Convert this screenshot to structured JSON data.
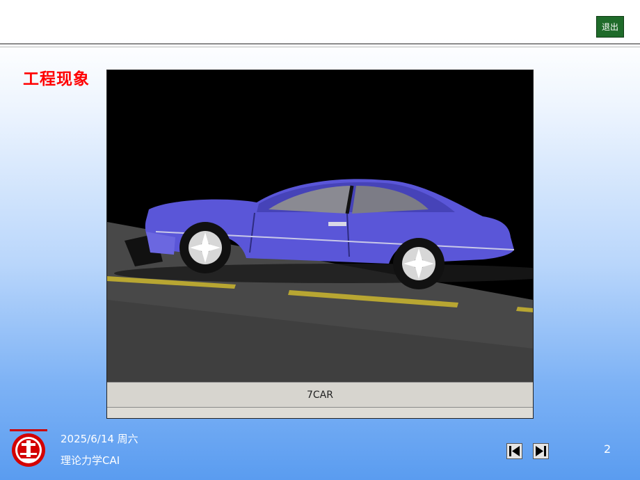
{
  "header": {
    "exit_label": "退出"
  },
  "slide": {
    "title": "工程现象",
    "video_caption": "7CAR"
  },
  "footer": {
    "date": "2025/6/14 周六",
    "course": "理论力学CAI",
    "page_number": "2"
  },
  "icons": {
    "first": "skip-to-start-icon",
    "next": "next-slide-icon",
    "logo": "university-emblem-icon"
  },
  "colors": {
    "title": "#ff0000",
    "exit_button": "#1f6b2a",
    "car_body": "#5a56d8",
    "road": "#4a4a4a",
    "lane_marking": "#b8a632"
  }
}
